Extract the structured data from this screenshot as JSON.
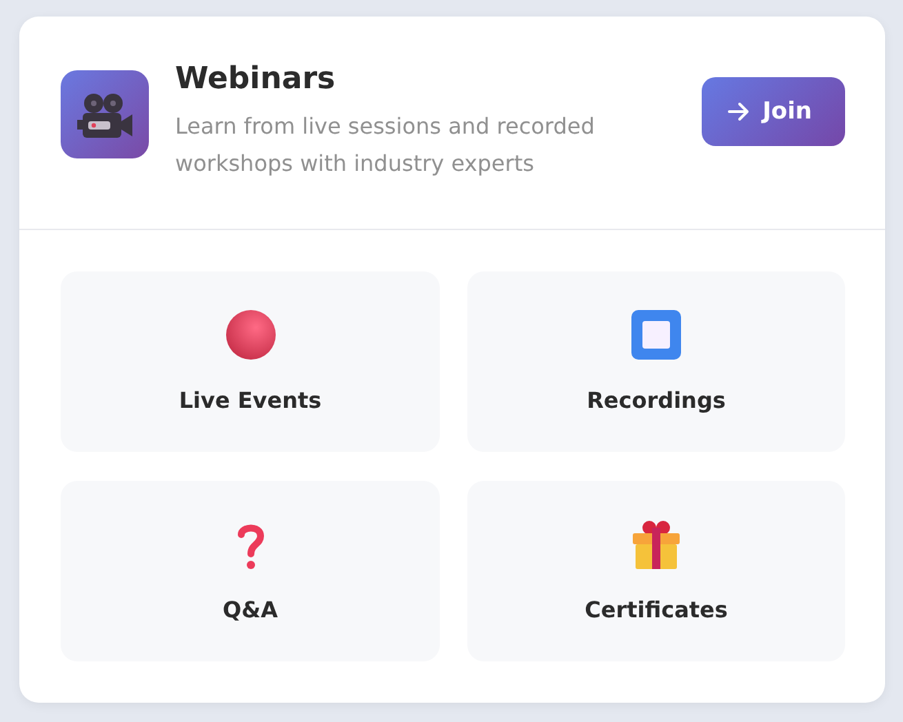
{
  "header": {
    "title": "Webinars",
    "description": "Learn from live sessions and recorded workshops with industry experts",
    "button": "Join"
  },
  "items": [
    {
      "kind": "record",
      "label": "Live Events"
    },
    {
      "kind": "stop",
      "label": "Recordings"
    },
    {
      "kind": "question",
      "label": "Q&A"
    },
    {
      "kind": "gift",
      "label": "Certificates"
    }
  ]
}
